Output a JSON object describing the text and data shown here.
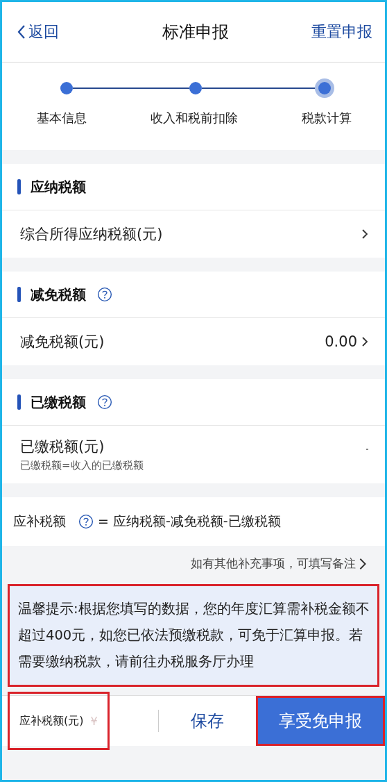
{
  "nav": {
    "back": "返回",
    "title": "标准申报",
    "action": "重置申报"
  },
  "steps": [
    {
      "label": "基本信息",
      "current": false
    },
    {
      "label": "收入和税前扣除",
      "current": false
    },
    {
      "label": "税款计算",
      "current": true
    }
  ],
  "sections": [
    {
      "title": "应纳税额",
      "help": false,
      "rows": [
        {
          "label": "综合所得应纳税额(元)",
          "chevron": true
        }
      ]
    },
    {
      "title": "减免税额",
      "help": true,
      "rows": [
        {
          "label": "减免税额(元)",
          "value": "0.00",
          "chevron": true
        }
      ]
    },
    {
      "title": "已缴税额",
      "help": true,
      "rows": [
        {
          "label": "已缴税额(元)",
          "note": "已缴税额=收入的已缴税额",
          "chevron": false
        }
      ]
    }
  ],
  "formula": {
    "label": "应补税额",
    "expression": "= 应纳税额-减免税额-已缴税额"
  },
  "remark_link": "如有其他补充事项，可填写备注",
  "notice": {
    "text": "温馨提示:根据您填写的数据，您的年度汇算需补税金额不超过400元，如您已依法预缴税款，可免于汇算申报。若需要缴纳税款，请前往办税服务厅办理",
    "highlighted": true
  },
  "bottom_bar": {
    "amount_label": "应补税额(元)",
    "currency": "¥",
    "amount_highlighted": true,
    "save": "保存",
    "submit": "享受免申报",
    "submit_highlighted": true
  }
}
